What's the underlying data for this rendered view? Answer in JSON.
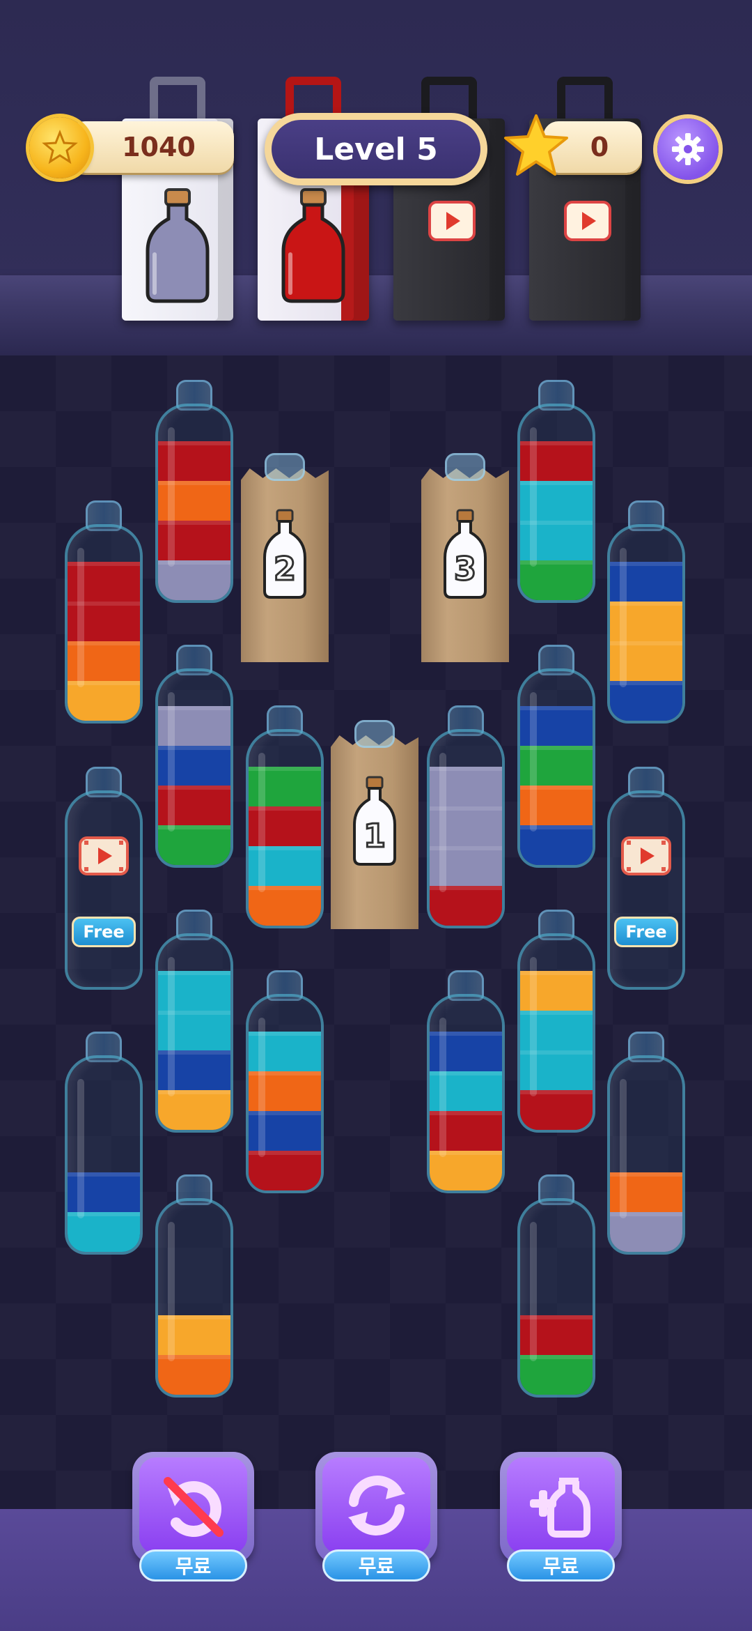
{
  "hud": {
    "coins": "1040",
    "level": "Level 5",
    "stars": "0"
  },
  "colors": {
    "red": "#b5121b",
    "orange": "#f06616",
    "amber": "#f7a72b",
    "lavender": "#8d8db5",
    "teal": "#1ab3c9",
    "green": "#1fa53d",
    "blue": "#1743a6"
  },
  "bags": [
    {
      "name": "bag-empty-bottle",
      "style": "white",
      "content": "bottle",
      "bottle_color": "#8d8db5"
    },
    {
      "name": "bag-red-bottle",
      "style": "white-red",
      "content": "bottle",
      "bottle_color": "#b5121b"
    },
    {
      "name": "bag-video-1",
      "style": "black",
      "content": "video"
    },
    {
      "name": "bag-video-2",
      "style": "black",
      "content": "video"
    }
  ],
  "tubes": [
    {
      "id": "t1",
      "layers": [
        "lavender",
        "red",
        "orange",
        "red"
      ]
    },
    {
      "id": "t2",
      "layers": [
        "amber",
        "orange",
        "red",
        "red"
      ]
    },
    {
      "id": "t3",
      "layers": [
        "green",
        "teal",
        "teal",
        "red"
      ]
    },
    {
      "id": "t4",
      "layers": [
        "blue",
        "amber",
        "amber",
        "blue"
      ]
    },
    {
      "id": "t5",
      "layers": [
        "green",
        "red",
        "blue",
        "lavender"
      ]
    },
    {
      "id": "t6",
      "layers": [
        "orange",
        "teal",
        "red",
        "green"
      ]
    },
    {
      "id": "t7",
      "layers": [
        "red",
        "lavender",
        "lavender",
        "lavender"
      ]
    },
    {
      "id": "t8",
      "layers": [
        "blue",
        "orange",
        "green",
        "blue"
      ]
    },
    {
      "id": "t9",
      "layers": [
        "amber",
        "blue",
        "teal",
        "teal"
      ]
    },
    {
      "id": "t10",
      "layers": [
        "red",
        "blue",
        "orange",
        "teal"
      ]
    },
    {
      "id": "t11",
      "layers": [
        "amber",
        "red",
        "teal",
        "blue"
      ]
    },
    {
      "id": "t12",
      "layers": [
        "red",
        "teal",
        "teal",
        "amber"
      ]
    },
    {
      "id": "t13",
      "layers": [
        "teal",
        "blue"
      ]
    },
    {
      "id": "t14",
      "layers": [
        "lavender",
        "orange"
      ]
    },
    {
      "id": "t15",
      "layers": [
        "orange",
        "amber"
      ]
    },
    {
      "id": "t16",
      "layers": [
        "green",
        "red"
      ]
    }
  ],
  "locked_tubes": [
    {
      "id": "locked-left",
      "label": "Free"
    },
    {
      "id": "locked-right",
      "label": "Free"
    }
  ],
  "sacks": [
    {
      "id": "sack-1",
      "number": "1"
    },
    {
      "id": "sack-2",
      "number": "2"
    },
    {
      "id": "sack-3",
      "number": "3"
    }
  ],
  "tools": [
    {
      "id": "tool-undo",
      "icon": "undo-disabled-icon",
      "label": "무료"
    },
    {
      "id": "tool-shuffle",
      "icon": "shuffle-icon",
      "label": "무료"
    },
    {
      "id": "tool-add-tube",
      "icon": "add-tube-icon",
      "label": "무료"
    }
  ]
}
